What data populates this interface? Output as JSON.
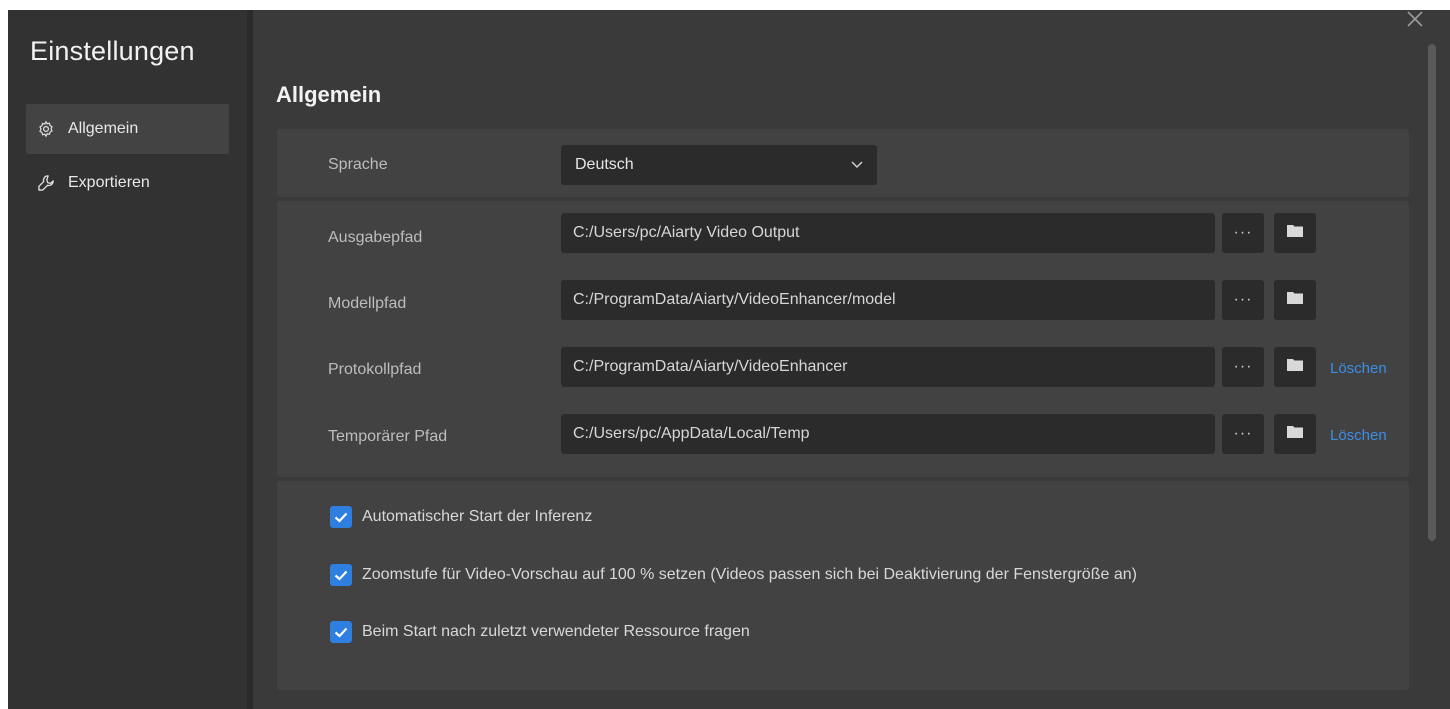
{
  "sidebar": {
    "title": "Einstellungen",
    "items": [
      {
        "label": "Allgemein",
        "icon": "gear-icon",
        "active": true
      },
      {
        "label": "Exportieren",
        "icon": "wrench-icon",
        "active": false
      }
    ]
  },
  "main": {
    "heading": "Allgemein",
    "language": {
      "label": "Sprache",
      "value": "Deutsch"
    },
    "paths": [
      {
        "label": "Ausgabepfad",
        "value": "C:/Users/pc/Aiarty Video Output",
        "delete": ""
      },
      {
        "label": "Modellpfad",
        "value": "C:/ProgramData/Aiarty/VideoEnhancer/model",
        "delete": ""
      },
      {
        "label": "Protokollpfad",
        "value": "C:/ProgramData/Aiarty/VideoEnhancer",
        "delete": "Löschen"
      },
      {
        "label": "Temporärer Pfad",
        "value": "C:/Users/pc/AppData/Local/Temp",
        "delete": "Löschen"
      }
    ],
    "more_button": "···",
    "options": [
      {
        "label": "Automatischer Start der Inferenz",
        "checked": true
      },
      {
        "label": "Zoomstufe für Video-Vorschau auf 100 % setzen (Videos passen sich bei Deaktivierung der Fenstergröße an)",
        "checked": true
      },
      {
        "label": "Beim Start nach zuletzt verwendeter Ressource fragen",
        "checked": true
      }
    ]
  },
  "colors": {
    "accent": "#2f7fe0",
    "link": "#3b8ee6",
    "background": "#3a3a3a",
    "sidebar": "#323232",
    "panel": "#424242",
    "field": "#2b2b2b"
  }
}
